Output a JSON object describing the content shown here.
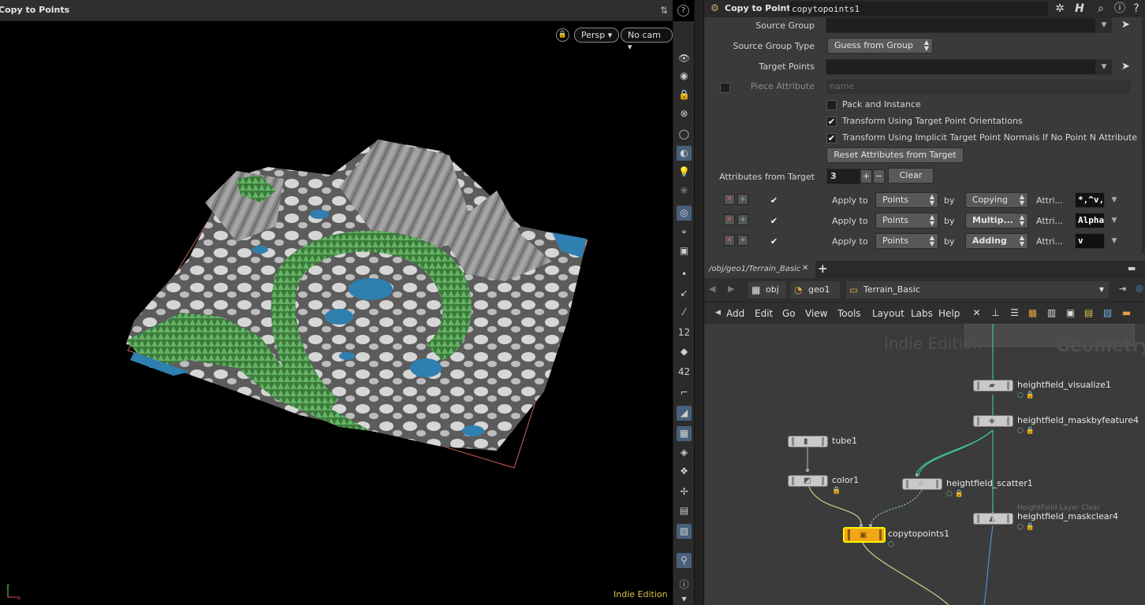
{
  "viewport": {
    "title": "Copy to Points",
    "camera_view": "Persp",
    "camera": "No cam",
    "edition": "Indie Edition"
  },
  "params": {
    "node_type": "Copy to Points",
    "node_name": "copytopoints1",
    "source_group_label": "Source Group",
    "source_group_value": "",
    "source_group_type_label": "Source Group Type",
    "source_group_type_value": "Guess from Group",
    "target_points_label": "Target Points",
    "target_points_value": "",
    "piece_attribute_label": "Piece Attribute",
    "piece_attribute_placeholder": "name",
    "pack_and_instance": {
      "label": "Pack and Instance",
      "checked": false
    },
    "transform_orient": {
      "label": "Transform Using Target Point Orientations",
      "checked": true
    },
    "transform_normals": {
      "label": "Transform Using Implicit Target Point Normals If No Point N Attribute",
      "checked": true
    },
    "reset_attributes_button": "Reset Attributes from Target",
    "attributes_from_target_label": "Attributes from Target",
    "attributes_count": "3",
    "clear_button": "Clear",
    "attr_rows": [
      {
        "apply_label": "Apply to",
        "apply_value": "Points",
        "by_label": "by",
        "method": "Copying",
        "attr_label": "Attri...",
        "attr_value": "*,^v,",
        "checked": true
      },
      {
        "apply_label": "Apply to",
        "apply_value": "Points",
        "by_label": "by",
        "method": "Multip...",
        "attr_label": "Attri...",
        "attr_value": "Alpha",
        "checked": true
      },
      {
        "apply_label": "Apply to",
        "apply_value": "Points",
        "by_label": "by",
        "method": "Adding",
        "attr_label": "Attri...",
        "attr_value": "v",
        "checked": true
      }
    ]
  },
  "network": {
    "tab_path": "/obj/geo1/Terrain_Basic",
    "path": [
      {
        "label": "obj",
        "icon": "obj-icon"
      },
      {
        "label": "geo1",
        "icon": "geo-icon"
      },
      {
        "label": "Terrain_Basic",
        "icon": "subnet-icon"
      }
    ],
    "menus": [
      "Add",
      "Edit",
      "Go",
      "View",
      "Tools",
      "Layout",
      "Labs",
      "Help"
    ],
    "watermark": "Indie Edition",
    "context_label": "Geometry",
    "nodes": {
      "heightfield_visualize1": "heightfield_visualize1",
      "heightfield_maskbyfeature4": "heightfield_maskbyfeature4",
      "tube1": "tube1",
      "color1": "color1",
      "heightfield_scatter1": "heightfield_scatter1",
      "heightfield_maskclear4": "heightfield_maskclear4",
      "heightfield_maskclear4_sub": "HeightField Layer Clear",
      "copytopoints1": "copytopoints1"
    }
  },
  "colors": {
    "selected_node": "#f1a717",
    "selected_outline": "#fff300",
    "wire_green": "#3fbf9a",
    "wire_blue": "#4f8fd8",
    "wire_yellow": "#c9cf8a",
    "bbox_red": "#d0605a",
    "terrain_water": "#2f7fb0",
    "terrain_trees": "#4a9a4a"
  }
}
